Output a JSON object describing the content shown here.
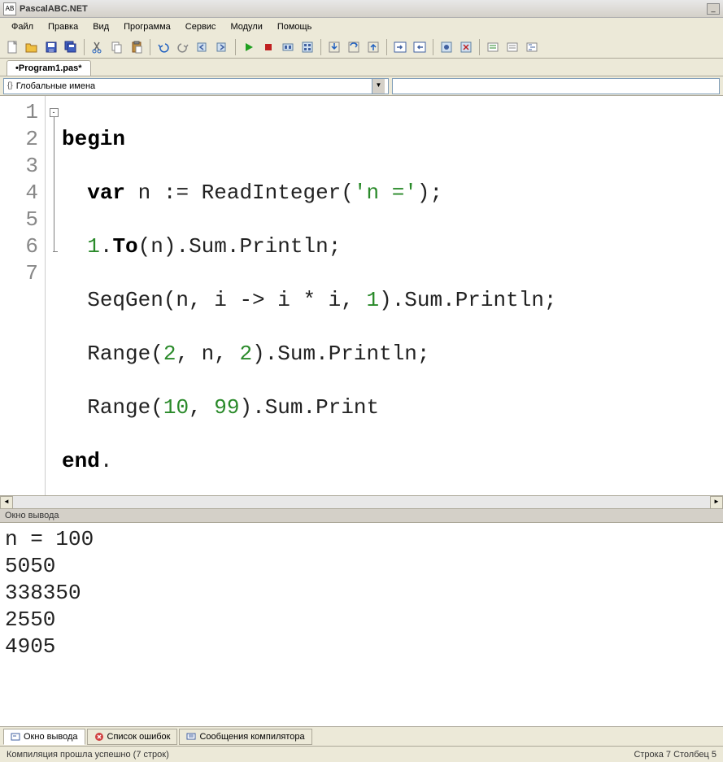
{
  "title": "PascalABC.NET",
  "menu": [
    "Файл",
    "Правка",
    "Вид",
    "Программа",
    "Сервис",
    "Модули",
    "Помощь"
  ],
  "file_tab": "•Program1.pas*",
  "nav_dropdown": "Глобальные имена",
  "code_lines": [
    {
      "n": "1"
    },
    {
      "n": "2"
    },
    {
      "n": "3"
    },
    {
      "n": "4"
    },
    {
      "n": "5"
    },
    {
      "n": "6"
    },
    {
      "n": "7"
    }
  ],
  "code": {
    "l1": {
      "kw": "begin"
    },
    "l2": {
      "indent": "  ",
      "kw1": "var",
      "t1": " n := ReadInteger(",
      "str": "'n ='",
      "t2": ");"
    },
    "l3": {
      "indent": "  ",
      "n1": "1",
      "t1": ".",
      "kw": "To",
      "t2": "(n).Sum.Println;"
    },
    "l4": {
      "indent": "  ",
      "t1": "SeqGen(n, i -> i * i, ",
      "n1": "1",
      "t2": ").Sum.Println;"
    },
    "l5": {
      "indent": "  ",
      "t1": "Range(",
      "n1": "2",
      "t2": ", n, ",
      "n2": "2",
      "t3": ").Sum.Println;"
    },
    "l6": {
      "indent": "  ",
      "t1": "Range(",
      "n1": "10",
      "t2": ", ",
      "n2": "99",
      "t3": ").Sum.Print"
    },
    "l7": {
      "kw": "end",
      "t": "."
    }
  },
  "output_header": "Окно вывода",
  "output_text": "n = 100\n5050\n338350\n2550\n4905",
  "bottom_tabs": {
    "t1": "Окно вывода",
    "t2": "Список ошибок",
    "t3": "Сообщения компилятора"
  },
  "status_left": "Компиляция прошла успешно (7 строк)",
  "status_right": "Строка  7 Столбец  5"
}
